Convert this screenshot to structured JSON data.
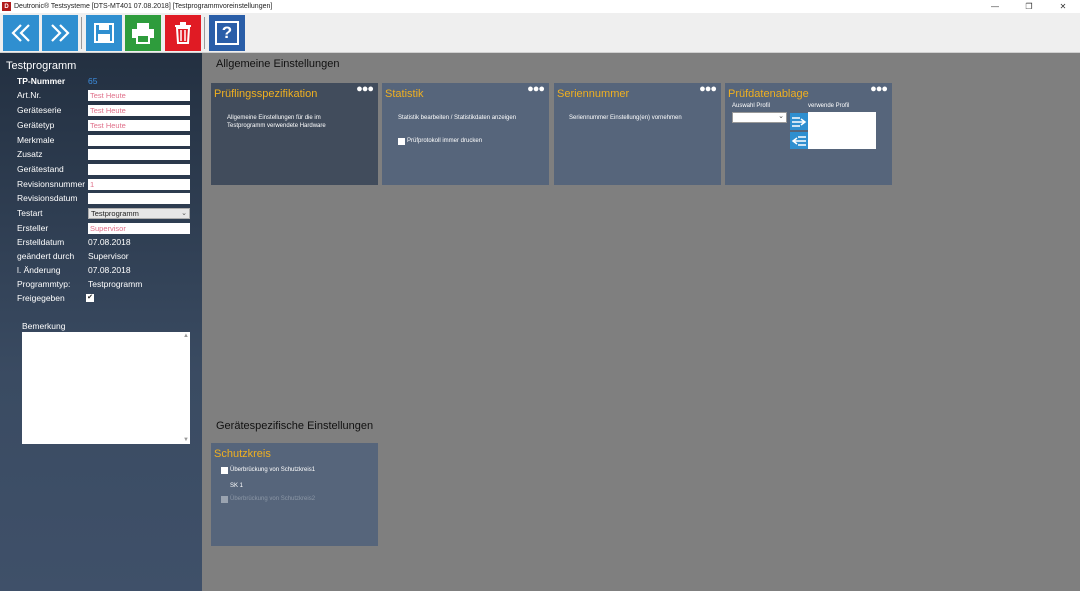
{
  "window": {
    "title": "Deutronic® Testsysteme [DTS-MT401  07.08.2018] [Testprogrammvoreinstellungen]",
    "logo_text": "D",
    "controls": {
      "minimize": "—",
      "maximize": "❐",
      "close": "✕"
    }
  },
  "toolbar": {
    "buttons": [
      {
        "id": "back",
        "icon": "double-chevron-left-icon",
        "color": "#2f8fd0"
      },
      {
        "id": "forward",
        "icon": "double-chevron-right-icon",
        "color": "#2f8fd0"
      },
      {
        "id": "save",
        "icon": "save-icon",
        "color": "#2f8fd0"
      },
      {
        "id": "print",
        "icon": "printer-icon",
        "color": "#2e9c3c"
      },
      {
        "id": "delete",
        "icon": "trash-icon",
        "color": "#e01b24"
      },
      {
        "id": "help",
        "icon": "help-icon",
        "color": "#2a5ea8",
        "label": "?"
      }
    ]
  },
  "sidebar": {
    "title": "Testprogramm",
    "fields": {
      "tp_nummer": {
        "label": "TP-Nummer",
        "value": "65"
      },
      "art_nr": {
        "label": "Art.Nr.",
        "value": "Test Heute"
      },
      "geraeteserie": {
        "label": "Geräteserie",
        "value": "Test Heute"
      },
      "geraetetyp": {
        "label": "Gerätetyp",
        "value": "Test Heute"
      },
      "merkmale": {
        "label": "Merkmale",
        "value": ""
      },
      "zusatz": {
        "label": "Zusatz",
        "value": ""
      },
      "geraetestand": {
        "label": "Gerätestand",
        "value": ""
      },
      "revisionsnummer": {
        "label": "Revisionsnummer",
        "value": "1"
      },
      "revisionsdatum": {
        "label": "Revisionsdatum",
        "value": ""
      },
      "testart": {
        "label": "Testart",
        "value": "Testprogramm"
      },
      "ersteller": {
        "label": "Ersteller",
        "value": "Supervisor"
      },
      "erstelldatum": {
        "label": "Erstelldatum",
        "value": "07.08.2018"
      },
      "geaendert_durch": {
        "label": "geändert durch",
        "value": "Supervisor"
      },
      "letzte_aenderung": {
        "label": "l. Änderung",
        "value": "07.08.2018"
      },
      "programmtyp": {
        "label": "Programmtyp:",
        "value": "Testprogramm"
      },
      "freigegeben": {
        "label": "Freigegeben",
        "checked": true,
        "mark": "✔"
      }
    },
    "bemerkung": {
      "label": "Bemerkung",
      "value": ""
    }
  },
  "main": {
    "allgemeine": {
      "title": "Allgemeine Einstellungen",
      "cards": {
        "pruefling": {
          "title": "Prüflingsspezifikation",
          "text": "Allgemeine Einstellungen für die im Testprogramm verwendete Hardware"
        },
        "statistik": {
          "title": "Statistik",
          "text": "Statistik bearbeiten / Statistikdaten anzeigen",
          "checkbox_label": "Prüfprotokoll immer drucken"
        },
        "seriennummer": {
          "title": "Seriennummer",
          "text": "Seriennummer Einstellung(en) vornehmen"
        },
        "pruefdaten": {
          "title": "Prüfdatenablage",
          "auswahl_label": "Auswahl Profil",
          "verwende_label": "verwende Profil",
          "auswahl_value": ""
        }
      }
    },
    "geraetespezifisch": {
      "title": "Gerätespezifische Einstellungen",
      "cards": {
        "schutzkreis": {
          "title": "Schutzkreis",
          "check1_label": "Überbrückung von Schutzkreis1",
          "sk_label": "SK 1",
          "check2_label": "Überbrückung von Schutzkreis2"
        }
      }
    },
    "dots": "●●●"
  }
}
